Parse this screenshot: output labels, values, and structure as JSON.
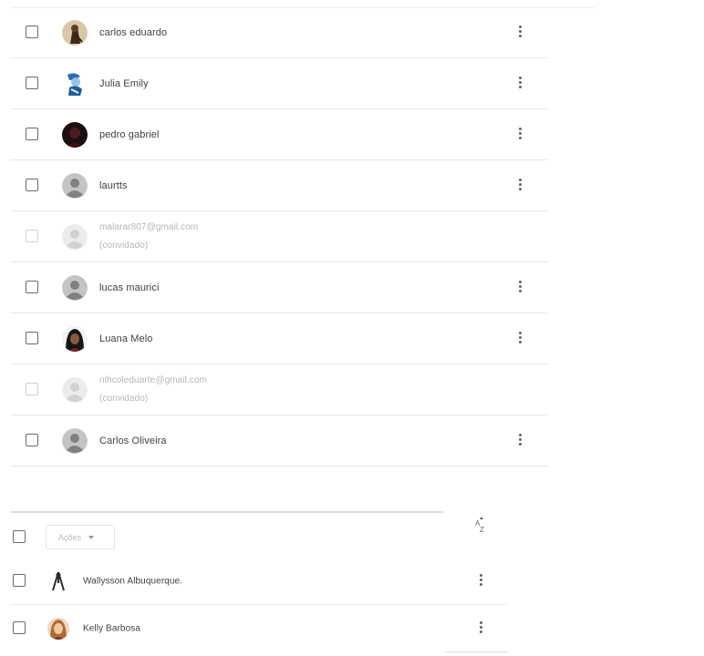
{
  "members": [
    {
      "name": "carlos eduardo",
      "avatar": "photo-dark-figure",
      "guest": false
    },
    {
      "name": "Julia Emily",
      "avatar": "photo-blue-cartoon",
      "guest": false
    },
    {
      "name": "pedro gabriel",
      "avatar": "photo-dark-red",
      "guest": false
    },
    {
      "name": "laurtts",
      "avatar": "default-person",
      "guest": false
    },
    {
      "name": "malarar807@gmail.com",
      "subtitle": "(convidado)",
      "avatar": "default-person",
      "guest": true
    },
    {
      "name": "lucas maurici",
      "avatar": "default-person",
      "guest": false
    },
    {
      "name": "Luana Melo",
      "avatar": "photo-dark-portrait",
      "guest": false
    },
    {
      "name": "nihcoleduarte@gmail.com",
      "subtitle": "(convidado)",
      "avatar": "default-person",
      "guest": true
    },
    {
      "name": "Carlos Oliveira",
      "avatar": "default-person",
      "guest": false
    }
  ],
  "toolbar": {
    "actions_label": "Ações",
    "sort_icon": "sort-az-icon"
  },
  "members2": [
    {
      "name": "Wallysson Albuquerque.",
      "avatar": "photo-figure"
    },
    {
      "name": "Kelly Barbosa",
      "avatar": "photo-woman"
    }
  ],
  "colors": {
    "text": "#3c4043",
    "guest_text": "#b5b5b5",
    "divider": "#e6e6e6"
  }
}
